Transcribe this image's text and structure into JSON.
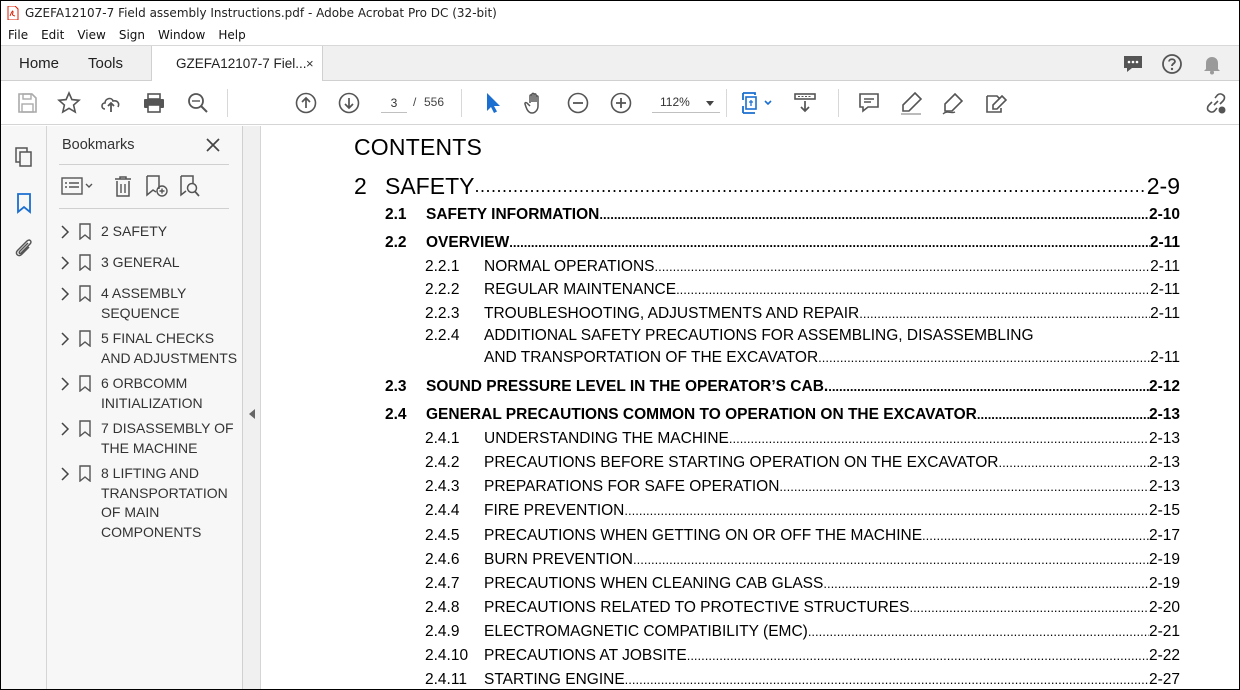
{
  "window": {
    "title": "GZEFA12107-7 Field assembly Instructions.pdf - Adobe Acrobat Pro DC (32-bit)"
  },
  "menu": [
    "File",
    "Edit",
    "View",
    "Sign",
    "Window",
    "Help"
  ],
  "tabs": {
    "home": "Home",
    "tools": "Tools",
    "document": "GZEFA12107-7 Fiel...",
    "close": "×"
  },
  "toolbar": {
    "current_page": "3",
    "page_sep": "/",
    "total_pages": "556",
    "zoom": "112%"
  },
  "bookmarks": {
    "title": "Bookmarks",
    "items": [
      {
        "label": "2 SAFETY"
      },
      {
        "label": "3 GENERAL"
      },
      {
        "label": "4 ASSEMBLY SEQUENCE"
      },
      {
        "label": "5 FINAL CHECKS AND ADJUSTMENTS"
      },
      {
        "label": "6 ORBCOMM INITIALIZATION"
      },
      {
        "label": "7 DISASSEMBLY OF THE MACHINE"
      },
      {
        "label": "8 LIFTING AND TRANSPORTATION OF MAIN COMPONENTS"
      }
    ]
  },
  "document": {
    "heading": "CONTENTS",
    "chapter": {
      "num": "2",
      "title": "SAFETY",
      "page": "2-9"
    },
    "entries": [
      {
        "level": "sec",
        "num": "2.1",
        "title": "SAFETY INFORMATION",
        "page": "2-10"
      },
      {
        "level": "sec",
        "num": "2.2",
        "title": "OVERVIEW",
        "page": "2-11"
      },
      {
        "level": "sub",
        "num": "2.2.1",
        "title": "NORMAL OPERATIONS",
        "page": "2-11"
      },
      {
        "level": "sub",
        "num": "2.2.2",
        "title": "REGULAR MAINTENANCE",
        "page": "2-11"
      },
      {
        "level": "sub",
        "num": "2.2.3",
        "title": "TROUBLESHOOTING, ADJUSTMENTS AND REPAIR",
        "page": "2-11"
      },
      {
        "level": "sub2",
        "num": "2.2.4",
        "title1": "ADDITIONAL SAFETY PRECAUTIONS FOR ASSEMBLING, DISASSEMBLING",
        "title": "AND TRANSPORTATION OF THE EXCAVATOR",
        "page": "2-11"
      },
      {
        "level": "sec",
        "num": "2.3",
        "title": "SOUND PRESSURE LEVEL IN THE OPERATOR’S CAB.",
        "page": "2-12"
      },
      {
        "level": "sec",
        "num": "2.4",
        "title": "GENERAL PRECAUTIONS COMMON TO OPERATION ON THE EXCAVATOR",
        "page": "2-13"
      },
      {
        "level": "sub",
        "num": "2.4.1",
        "title": "UNDERSTANDING THE MACHINE",
        "page": "2-13"
      },
      {
        "level": "sub",
        "num": "2.4.2",
        "title": "PRECAUTIONS BEFORE STARTING OPERATION ON THE EXCAVATOR",
        "page": "2-13"
      },
      {
        "level": "sub",
        "num": "2.4.3",
        "title": "PREPARATIONS FOR SAFE OPERATION",
        "page": "2-13"
      },
      {
        "level": "sub",
        "num": "2.4.4",
        "title": "FIRE PREVENTION",
        "page": "2-15"
      },
      {
        "level": "sub",
        "num": "2.4.5",
        "title": "PRECAUTIONS WHEN GETTING ON OR OFF THE MACHINE",
        "page": "2-17"
      },
      {
        "level": "sub",
        "num": "2.4.6",
        "title": "BURN PREVENTION",
        "page": "2-19"
      },
      {
        "level": "sub",
        "num": "2.4.7",
        "title": "PRECAUTIONS WHEN CLEANING CAB GLASS",
        "page": "2-19"
      },
      {
        "level": "sub",
        "num": "2.4.8",
        "title": "PRECAUTIONS RELATED TO PROTECTIVE STRUCTURES",
        "page": "2-20"
      },
      {
        "level": "sub",
        "num": "2.4.9",
        "title": "ELECTROMAGNETIC COMPATIBILITY (EMC)",
        "page": "2-21"
      },
      {
        "level": "sub",
        "num": "2.4.10",
        "title": "PRECAUTIONS AT JOBSITE",
        "page": "2-22"
      },
      {
        "level": "sub",
        "num": "2.4.11",
        "title": "STARTING ENGINE",
        "page": "2-27"
      }
    ]
  },
  "colors": {
    "accent_blue": "#1a6fd1",
    "icon_gray": "#555555",
    "acrobat_red": "#d81e05"
  }
}
